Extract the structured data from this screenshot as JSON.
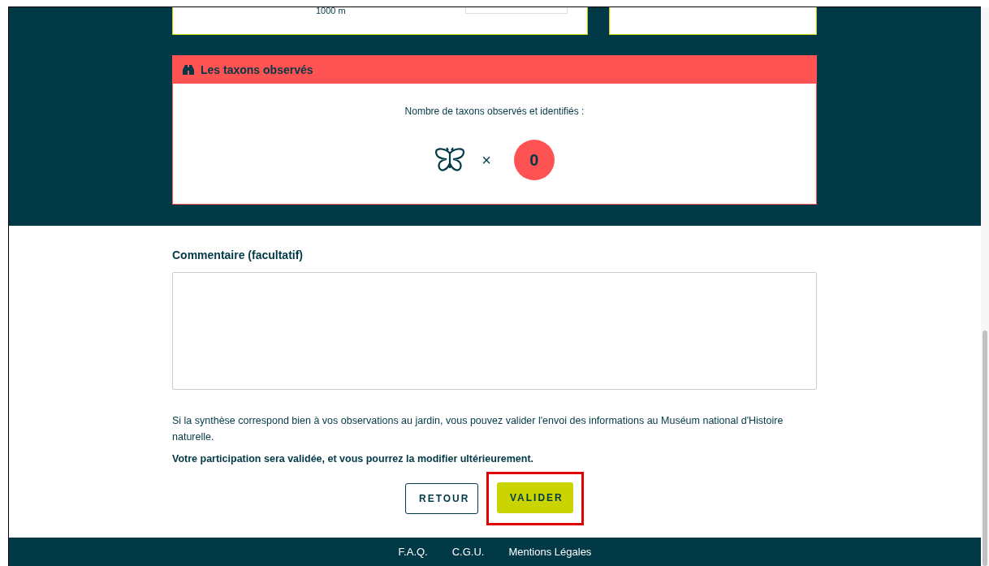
{
  "top_cards": {
    "distance": "1000 m"
  },
  "taxa_panel": {
    "title": "Les taxons observés",
    "label": "Nombre de taxons observés et identifiés :",
    "multiplier": "×",
    "count": "0"
  },
  "comment": {
    "label": "Commentaire (facultatif)"
  },
  "info_text": "Si la synthèse correspond bien à vos observations au jardin, vous pouvez valider l'envoi des informations au Muséum national d'Histoire naturelle.",
  "notice": "Votre participation sera validée, et vous pourrez la modifier ultérieurement.",
  "buttons": [
    {
      "label": "RETOUR",
      "kind": "outline",
      "highlighted": false
    },
    {
      "label": "VALIDER",
      "kind": "primary",
      "highlighted": true
    }
  ],
  "footer_links": [
    "F.A.Q.",
    "C.G.U.",
    "Mentions Légales"
  ]
}
